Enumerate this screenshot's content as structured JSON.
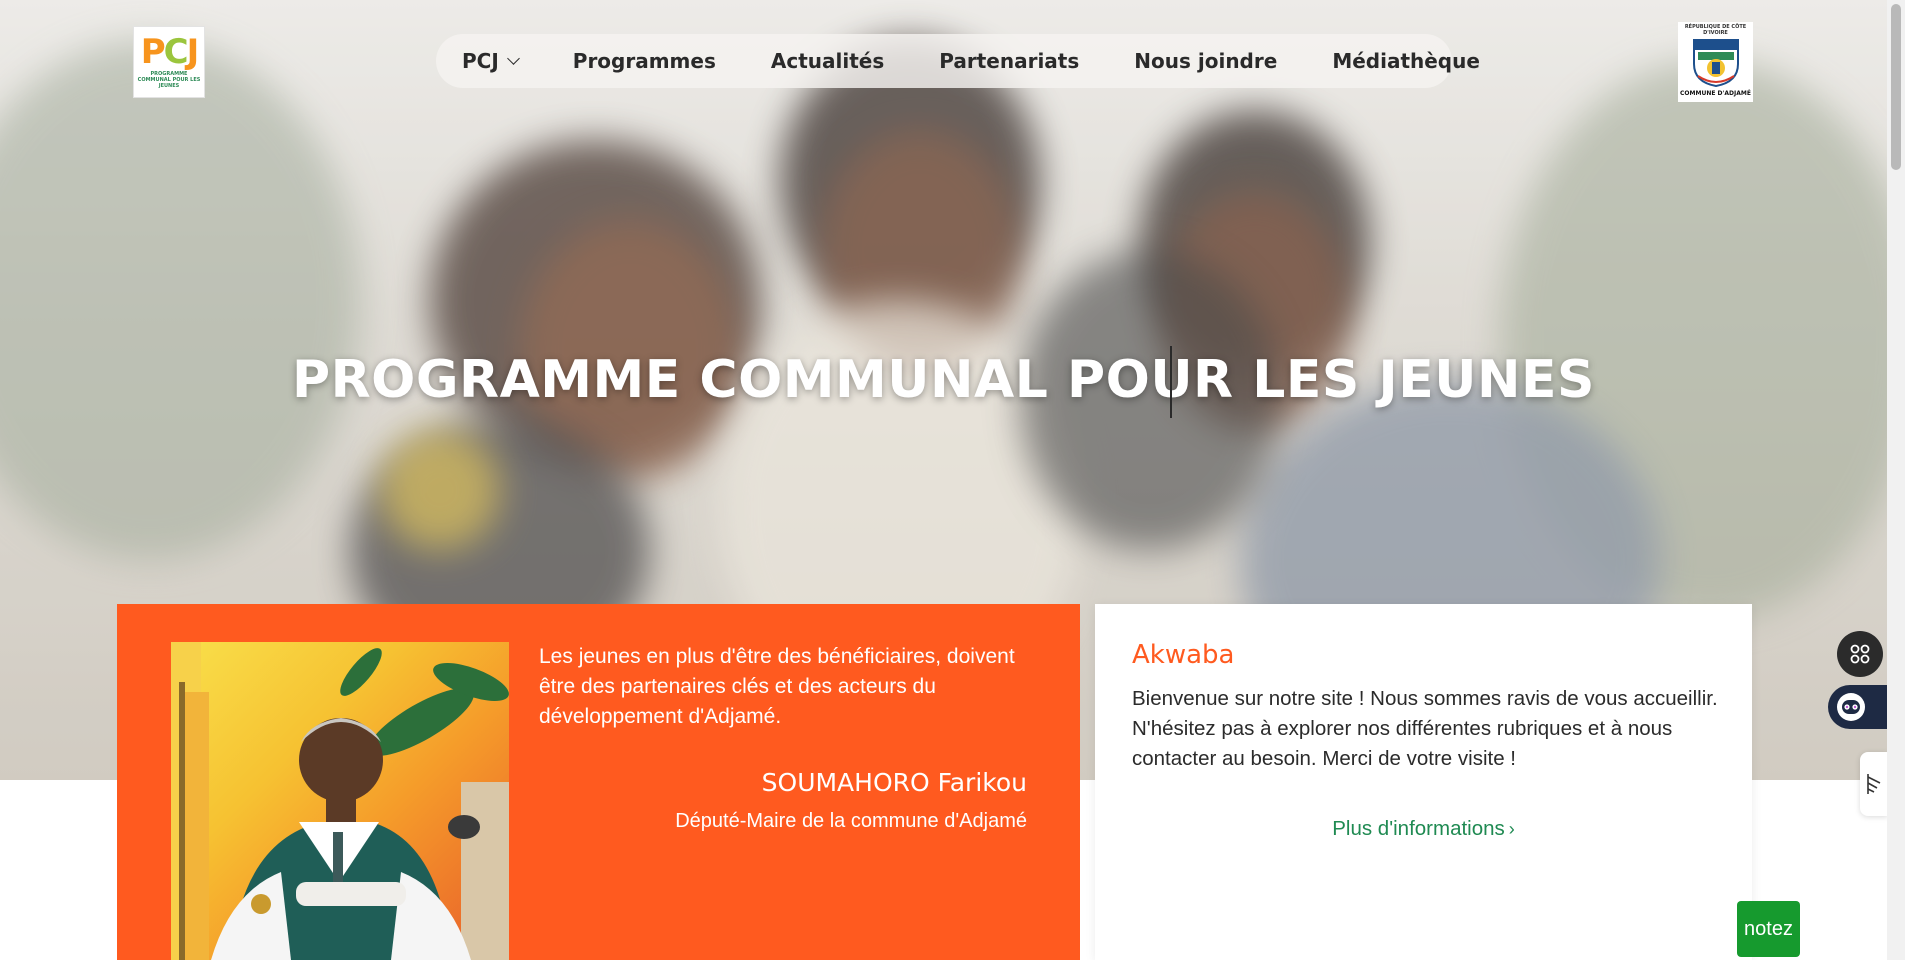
{
  "header": {
    "logo_left": {
      "letters": [
        "P",
        "C",
        "J"
      ],
      "tagline": "PROGRAMME COMMUNAL POUR LES JEUNES"
    },
    "nav": [
      {
        "label": "PCJ",
        "has_dropdown": true
      },
      {
        "label": "Programmes"
      },
      {
        "label": "Actualités"
      },
      {
        "label": "Partenariats"
      },
      {
        "label": "Nous joindre"
      },
      {
        "label": "Médiathèque"
      }
    ],
    "logo_right": {
      "caption_top": "RÉPUBLIQUE DE CÔTE D'IVOIRE",
      "caption_bottom": "COMMUNE D'ADJAMÉ"
    }
  },
  "hero": {
    "title": "PROGRAMME COMMUNAL POUR LES JEUNES"
  },
  "mayor_card": {
    "quote": "Les jeunes en plus d'être des bénéficiaires, doivent être des partenaires clés et des acteurs du développement d'Adjamé.",
    "name": "SOUMAHORO Farikou",
    "role": "Député-Maire de la commune d'Adjamé"
  },
  "welcome_card": {
    "title": "Akwaba",
    "text": "Bienvenue sur notre site ! Nous sommes ravis de vous accueillir. N'hésitez pas à explorer nos différentes rubriques et à nous contacter au besoin. Merci de votre visite !",
    "link_label": "Plus d'informations",
    "link_arrow": "›"
  },
  "widgets": {
    "notez_label": "notez",
    "icons": [
      "grid-icon",
      "chatbot-icon",
      "feedback-icon"
    ]
  },
  "colors": {
    "orange": "#ff5a1f",
    "green_link": "#1f8a52",
    "notez_green": "#169a2e",
    "logo_orange": "#f7941d",
    "logo_green": "#9bc53d"
  }
}
